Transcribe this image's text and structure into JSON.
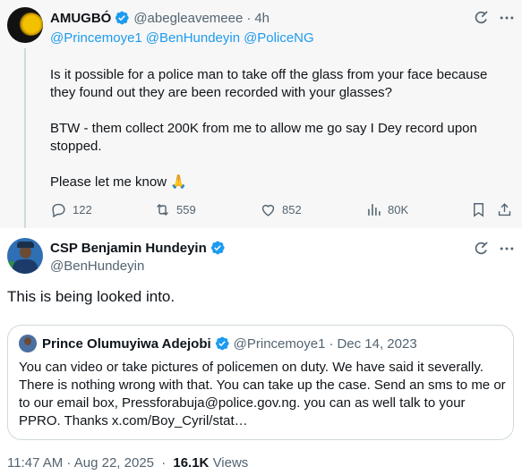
{
  "reply_tweet": {
    "author_name": "AMUGBÓ",
    "handle": "@abegleavemeee",
    "time": "4h",
    "mentions": [
      "@Princemoye1",
      "@BenHundeyin",
      "@PoliceNG"
    ],
    "paragraphs": [
      "Is it possible for a police man to take off the glass from your face because they found out they are been recorded with your glasses?",
      "BTW - them collect 200K from me to allow me go say I Dey record upon stopped.",
      "Please let me know 🙏"
    ],
    "stats": {
      "replies": "122",
      "reposts": "559",
      "likes": "852",
      "views": "80K"
    }
  },
  "main_tweet": {
    "author_name": "CSP Benjamin Hundeyin",
    "handle": "@BenHundeyin",
    "text": "This is being looked into.",
    "quote": {
      "author_name": "Prince Olumuyiwa Adejobi",
      "handle": "@Princemoye1",
      "date": "Dec 14, 2023",
      "text": "You can video or take pictures of policemen on duty. We have said it severally. There is nothing wrong with that. You can take up the case. Send an sms to me or to our email box, Pressforabuja@police.gov.ng. you can as well talk to your PPRO.  Thanks x.com/Boy_Cyril/stat…"
    },
    "timestamp": "11:47 AM · Aug 22, 2025",
    "views_count": "16.1K",
    "views_label": "Views"
  },
  "icons": [
    "verified-badge-icon",
    "grok-icon",
    "more-icon",
    "reply-icon",
    "repost-icon",
    "like-icon",
    "views-icon",
    "bookmark-icon",
    "share-icon"
  ],
  "colors": {
    "link": "#1d9bf0",
    "muted": "#536471",
    "text": "#0f1419",
    "reply_bg": "#f7f7f7"
  }
}
